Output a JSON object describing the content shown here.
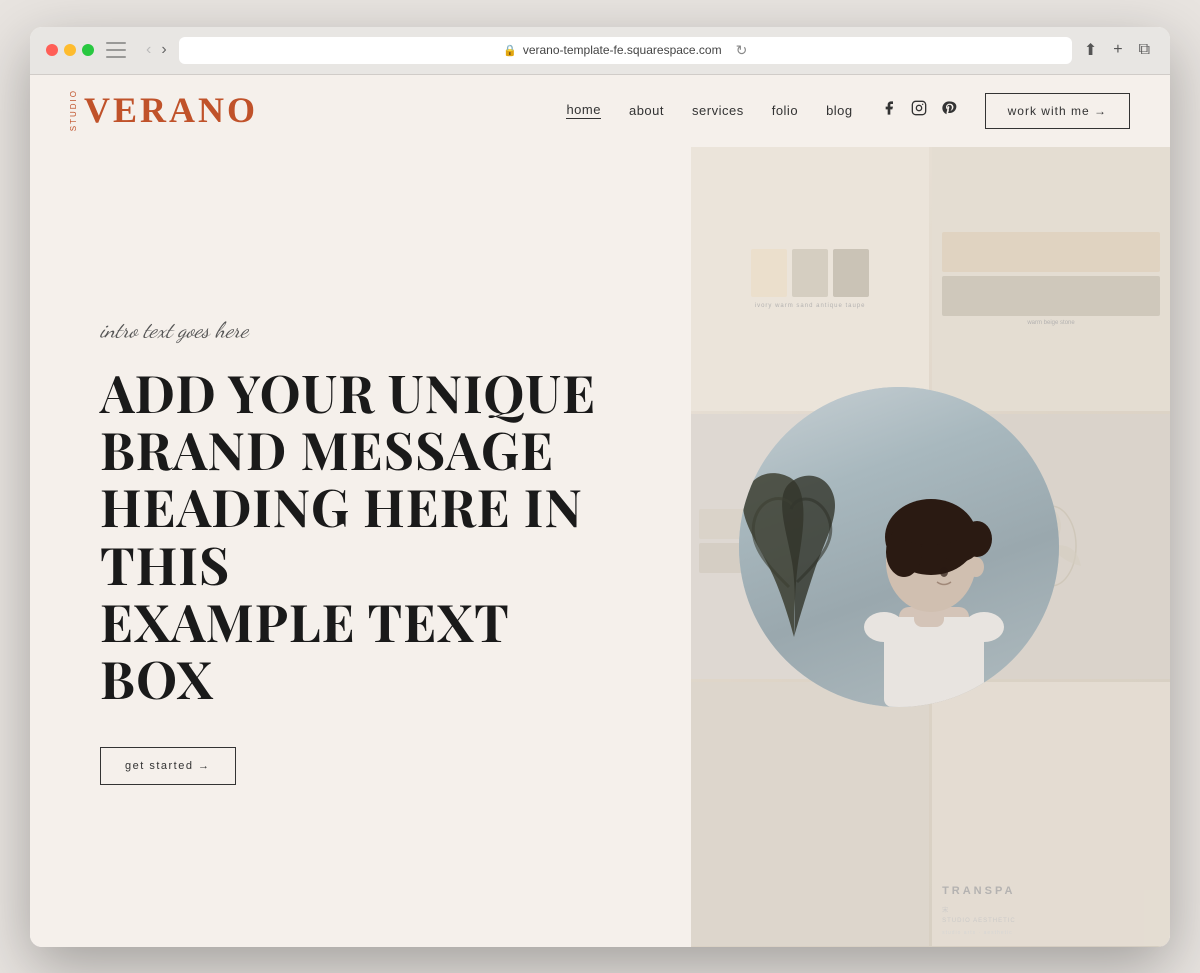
{
  "browser": {
    "url": "verano-template-fe.squarespace.com",
    "back_button": "‹",
    "forward_button": "›"
  },
  "site": {
    "logo": {
      "studio_label": "STUDIO",
      "brand_name": "VERANO"
    },
    "nav": {
      "items": [
        {
          "label": "home",
          "active": true
        },
        {
          "label": "about",
          "active": false
        },
        {
          "label": "services",
          "active": false
        },
        {
          "label": "folio",
          "active": false
        },
        {
          "label": "blog",
          "active": false
        }
      ],
      "social": {
        "facebook": "f",
        "instagram": "◯",
        "pinterest": "P"
      },
      "cta_label": "work with me →"
    },
    "hero": {
      "intro_text": "intro text goes here",
      "heading_line1": "ADD YOUR UNIQUE",
      "heading_line2": "BRAND MESSAGE",
      "heading_line3": "HEADING HERE IN THIS",
      "heading_line4": "EXAMPLE TEXT BOX",
      "get_started_label": "get started →"
    }
  }
}
